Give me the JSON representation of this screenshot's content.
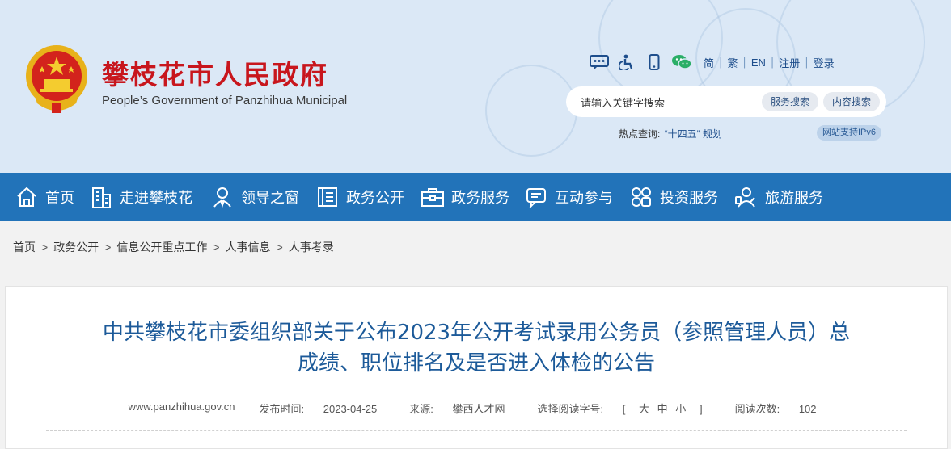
{
  "header": {
    "site_title": "攀枝花市人民政府",
    "site_subtitle": "People’s Government of Panzhihua Municipal",
    "toolbar": {
      "icons": [
        "message-icon",
        "accessibility-icon",
        "mobile-icon",
        "wechat-icon"
      ],
      "links": [
        "简",
        "繁",
        "EN",
        "注册",
        "登录"
      ]
    },
    "search": {
      "placeholder": "请输入关键字搜索",
      "service_search": "服务搜索",
      "content_search": "内容搜索"
    },
    "hotwords": {
      "label": "热点查询:",
      "items": [
        "“十四五” 规划"
      ]
    },
    "ipv6_badge": "网站支持IPv6"
  },
  "nav": {
    "items": [
      {
        "label": "首页",
        "icon": "home-icon"
      },
      {
        "label": "走进攀枝花",
        "icon": "building-icon"
      },
      {
        "label": "领导之窗",
        "icon": "person-icon"
      },
      {
        "label": "政务公开",
        "icon": "document-icon"
      },
      {
        "label": "政务服务",
        "icon": "briefcase-icon"
      },
      {
        "label": "互动参与",
        "icon": "chat-icon"
      },
      {
        "label": "投资服务",
        "icon": "grid-icon"
      },
      {
        "label": "旅游服务",
        "icon": "traveler-icon"
      }
    ]
  },
  "breadcrumb": {
    "items": [
      "首页",
      "政务公开",
      "信息公开重点工作",
      "人事信息",
      "人事考录"
    ],
    "separator": ">"
  },
  "article": {
    "title_line1": "中共攀枝花市委组织部关于公布2023年公开考试录用公务员（参照管理人员）总",
    "title_line2": "成绩、职位排名及是否进入体检的公告",
    "meta": {
      "site": "www.panzhihua.gov.cn",
      "publish_label": "发布时间:",
      "publish_date": "2023-04-25",
      "source_label": "来源:",
      "source": "攀西人才网",
      "font_label": "选择阅读字号:",
      "bracket_open": "[",
      "sizes": [
        "大",
        "中",
        "小"
      ],
      "bracket_close": "]",
      "views_label": "阅读次数:",
      "views": "102"
    }
  },
  "colors": {
    "nav_bg": "#2273b9",
    "title_red": "#c8161d",
    "article_title": "#1c5a99",
    "header_bg": "#dbe8f6"
  }
}
